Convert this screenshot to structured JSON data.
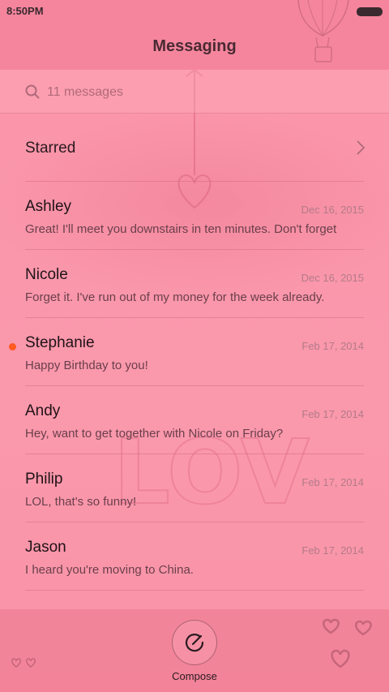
{
  "status_bar": {
    "time": "8:50PM"
  },
  "header": {
    "title": "Messaging"
  },
  "search": {
    "placeholder": "11 messages"
  },
  "starred": {
    "label": "Starred"
  },
  "messages": [
    {
      "name": "Ashley",
      "date": "Dec 16, 2015",
      "snippet": "Great! I'll meet you downstairs in ten minutes. Don't forget",
      "unread": false
    },
    {
      "name": "Nicole",
      "date": "Dec 16, 2015",
      "snippet": "Forget it. I've run out of my money for the week already.",
      "unread": false
    },
    {
      "name": "Stephanie",
      "date": "Feb 17, 2014",
      "snippet": "Happy Birthday to you!",
      "unread": true
    },
    {
      "name": "Andy",
      "date": "Feb 17, 2014",
      "snippet": "Hey, want to get together with Nicole on Friday?",
      "unread": false
    },
    {
      "name": "Philip",
      "date": "Feb 17, 2014",
      "snippet": "LOL, that's so funny!",
      "unread": false
    },
    {
      "name": "Jason",
      "date": "Feb 17, 2014",
      "snippet": "I heard you're moving to China.",
      "unread": false
    }
  ],
  "footer": {
    "compose_label": "Compose"
  },
  "colors": {
    "unread_dot": "#ff5a1f",
    "background": "#fa93a8"
  },
  "icons": {
    "search": "search-icon",
    "starred_arrow": "chevron-right-icon",
    "compose": "compose-icon"
  }
}
